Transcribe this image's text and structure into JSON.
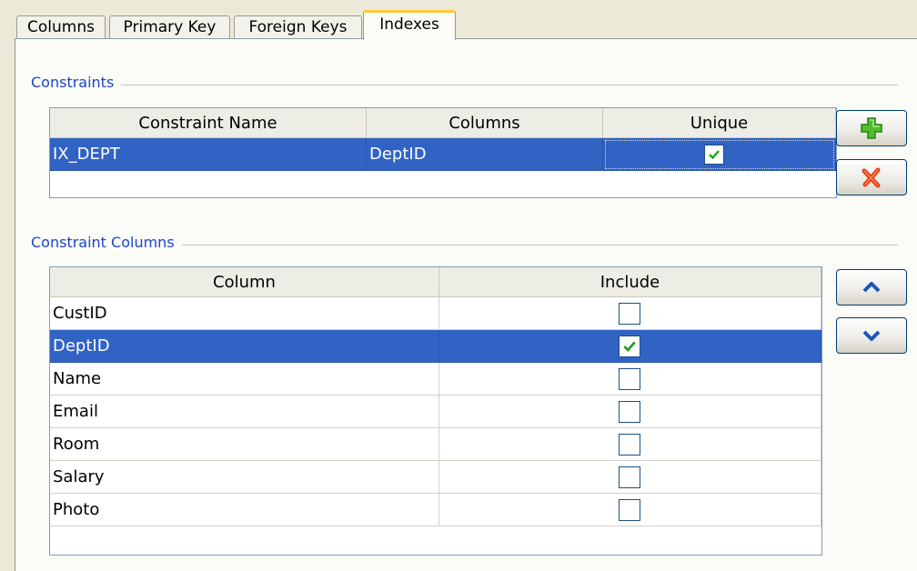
{
  "tabs": [
    {
      "label": "Columns",
      "active": false
    },
    {
      "label": "Primary Key",
      "active": false
    },
    {
      "label": "Foreign Keys",
      "active": false
    },
    {
      "label": "Indexes",
      "active": true
    }
  ],
  "constraints": {
    "title": "Constraints",
    "headers": {
      "name": "Constraint Name",
      "columns": "Columns",
      "unique": "Unique"
    },
    "rows": [
      {
        "name": "IX_DEPT",
        "columns": "DeptID",
        "unique": true,
        "selected": true
      }
    ],
    "add_button_icon": "add-icon",
    "delete_button_icon": "delete-icon"
  },
  "constraint_columns": {
    "title": "Constraint Columns",
    "headers": {
      "column": "Column",
      "include": "Include"
    },
    "rows": [
      {
        "column": "CustID",
        "include": false,
        "selected": false
      },
      {
        "column": "DeptID",
        "include": true,
        "selected": true
      },
      {
        "column": "Name",
        "include": false,
        "selected": false
      },
      {
        "column": "Email",
        "include": false,
        "selected": false
      },
      {
        "column": "Room",
        "include": false,
        "selected": false
      },
      {
        "column": "Salary",
        "include": false,
        "selected": false
      },
      {
        "column": "Photo",
        "include": false,
        "selected": false
      }
    ],
    "move_up_icon": "arrow-up-icon",
    "move_down_icon": "arrow-down-icon"
  },
  "colors": {
    "selection": "#3163c5",
    "section_title": "#1e46c8",
    "active_tab_accent": "#ffc73c"
  }
}
